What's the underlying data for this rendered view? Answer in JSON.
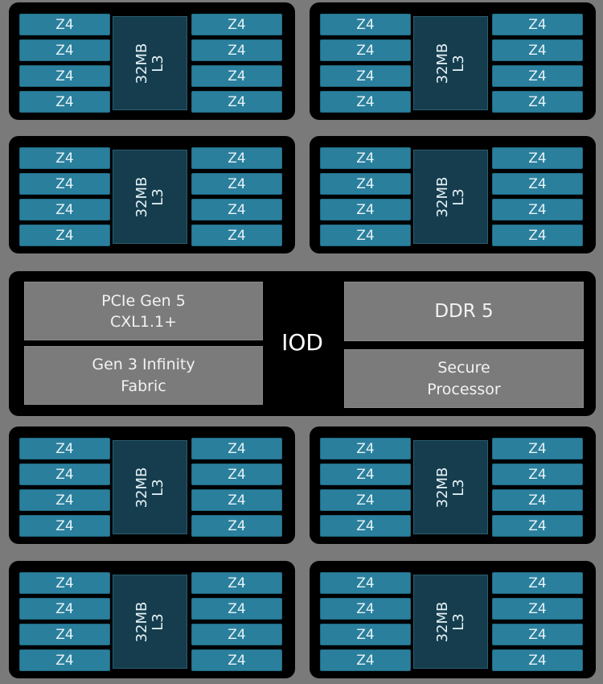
{
  "ccds": [
    {
      "id": "ccd-1",
      "cache": {
        "line1": "32MB",
        "line2": "L3"
      },
      "left_cores": [
        "Z4",
        "Z4",
        "Z4",
        "Z4"
      ],
      "right_cores": [
        "Z4",
        "Z4",
        "Z4",
        "Z4"
      ]
    },
    {
      "id": "ccd-2",
      "cache": {
        "line1": "32MB",
        "line2": "L3"
      },
      "left_cores": [
        "Z4",
        "Z4",
        "Z4",
        "Z4"
      ],
      "right_cores": [
        "Z4",
        "Z4",
        "Z4",
        "Z4"
      ]
    },
    {
      "id": "ccd-3",
      "cache": {
        "line1": "32MB",
        "line2": "L3"
      },
      "left_cores": [
        "Z4",
        "Z4",
        "Z4",
        "Z4"
      ],
      "right_cores": [
        "Z4",
        "Z4",
        "Z4",
        "Z4"
      ]
    },
    {
      "id": "ccd-4",
      "cache": {
        "line1": "32MB",
        "line2": "L3"
      },
      "left_cores": [
        "Z4",
        "Z4",
        "Z4",
        "Z4"
      ],
      "right_cores": [
        "Z4",
        "Z4",
        "Z4",
        "Z4"
      ]
    },
    {
      "id": "ccd-5",
      "cache": {
        "line1": "32MB",
        "line2": "L3"
      },
      "left_cores": [
        "Z4",
        "Z4",
        "Z4",
        "Z4"
      ],
      "right_cores": [
        "Z4",
        "Z4",
        "Z4",
        "Z4"
      ]
    },
    {
      "id": "ccd-6",
      "cache": {
        "line1": "32MB",
        "line2": "L3"
      },
      "left_cores": [
        "Z4",
        "Z4",
        "Z4",
        "Z4"
      ],
      "right_cores": [
        "Z4",
        "Z4",
        "Z4",
        "Z4"
      ]
    },
    {
      "id": "ccd-7",
      "cache": {
        "line1": "32MB",
        "line2": "L3"
      },
      "left_cores": [
        "Z4",
        "Z4",
        "Z4",
        "Z4"
      ],
      "right_cores": [
        "Z4",
        "Z4",
        "Z4",
        "Z4"
      ]
    },
    {
      "id": "ccd-8",
      "cache": {
        "line1": "32MB",
        "line2": "L3"
      },
      "left_cores": [
        "Z4",
        "Z4",
        "Z4",
        "Z4"
      ],
      "right_cores": [
        "Z4",
        "Z4",
        "Z4",
        "Z4"
      ]
    }
  ],
  "iod": {
    "label": "IOD",
    "pcie": {
      "line1": "PCIe Gen 5",
      "line2": "CXL1.1+"
    },
    "infinity_fabric": {
      "line1": "Gen 3 Infinity",
      "line2": "Fabric"
    },
    "ddr": {
      "line1": "DDR 5"
    },
    "secure_processor": {
      "line1": "Secure",
      "line2": "Processor"
    }
  },
  "colors": {
    "core": "#2a7f9c",
    "cache": "#153d4e",
    "die": "#000000",
    "background": "#7a7a7a",
    "iod_block": "#7b7b7b"
  }
}
